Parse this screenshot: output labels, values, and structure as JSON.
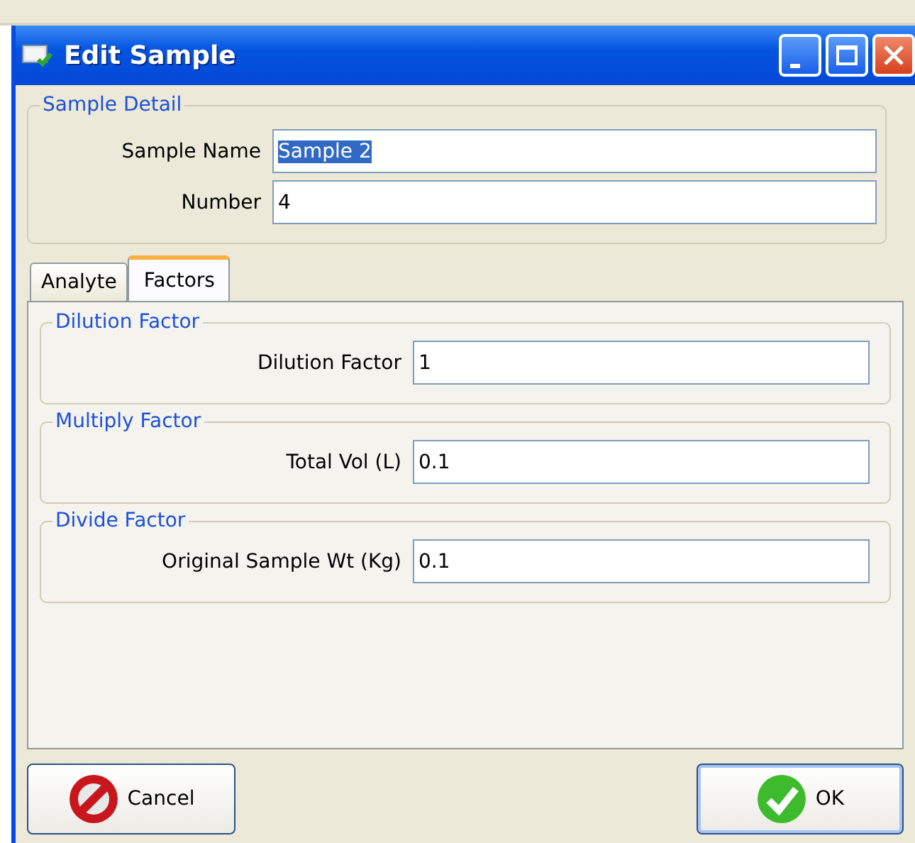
{
  "window": {
    "title": "Edit Sample"
  },
  "sample_detail": {
    "title": "Sample Detail",
    "fields": [
      {
        "label": "Sample Name",
        "value": "Sample 2",
        "highlighted": true
      },
      {
        "label": "Number",
        "value": "4",
        "highlighted": false
      }
    ]
  },
  "tabs": [
    {
      "label": "Analyte",
      "selected": false
    },
    {
      "label": "Factors",
      "selected": true
    }
  ],
  "groups": [
    {
      "title": "Dilution Factor",
      "label": "Dilution Factor",
      "value": "1"
    },
    {
      "title": "Multiply Factor",
      "label": "Total Vol (L)",
      "value": "0.1"
    },
    {
      "title": "Divide Factor",
      "label": "Original Sample Wt (Kg)",
      "value": "0.1"
    }
  ],
  "buttons": [
    {
      "kind": "cancel",
      "label": "Cancel",
      "default": false
    },
    {
      "kind": "ok",
      "label": "OK",
      "default": true
    }
  ]
}
